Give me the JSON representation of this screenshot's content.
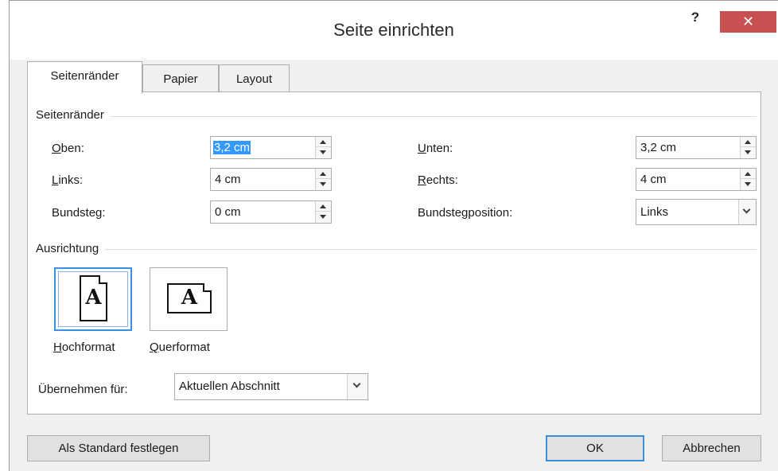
{
  "window": {
    "title": "Seite einrichten",
    "help_label": "?",
    "close_label": "✕"
  },
  "tabs": [
    {
      "label": "Seitenränder",
      "active": true
    },
    {
      "label": "Papier",
      "active": false
    },
    {
      "label": "Layout",
      "active": false
    }
  ],
  "margins": {
    "group_label": "Seitenränder",
    "top": {
      "label": "Oben:",
      "value": "3,2 cm"
    },
    "bottom": {
      "label": "Unten:",
      "value": "3,2 cm"
    },
    "left": {
      "label": "Links:",
      "value": "4 cm"
    },
    "right": {
      "label": "Rechts:",
      "value": "4 cm"
    },
    "gutter": {
      "label": "Bundsteg:",
      "value": "0 cm"
    },
    "gutter_position": {
      "label": "Bundstegposition:",
      "value": "Links"
    }
  },
  "orientation": {
    "group_label": "Ausrichtung",
    "portrait": {
      "label": "Hochformat",
      "icon_letter": "A",
      "selected": true
    },
    "landscape": {
      "label": "Querformat",
      "icon_letter": "A",
      "selected": false
    }
  },
  "apply_to": {
    "label": "Übernehmen für:",
    "value": "Aktuellen Abschnitt"
  },
  "buttons": {
    "set_default": "Als Standard festlegen",
    "ok": "OK",
    "cancel": "Abbrechen"
  },
  "colors": {
    "accent": "#3c8fe0",
    "close": "#c75050",
    "selection": "#3399ff"
  }
}
